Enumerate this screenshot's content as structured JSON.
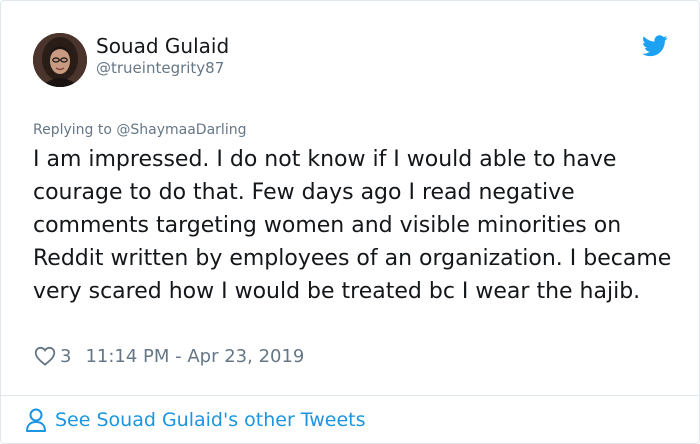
{
  "author": {
    "display_name": "Souad Gulaid",
    "handle": "@trueintegrity87"
  },
  "reply": {
    "prefix": "Replying to ",
    "mention": "@ShaymaaDarling"
  },
  "tweet": {
    "text": "I am impressed. I do not know if I would able to have courage to do that. Few days ago I read negative comments targeting women and visible minorities on Reddit written by employees of an organization. I became very scared how I would be treated bc I wear the hajib.",
    "like_count": "3",
    "timestamp": "11:14 PM - Apr 23, 2019"
  },
  "footer": {
    "link_text": "See Souad Gulaid's other Tweets"
  },
  "icons": {
    "brand": "twitter-bird-icon",
    "like": "heart-icon",
    "profile": "person-icon"
  },
  "colors": {
    "brand_blue": "#1da1f2",
    "link_blue": "#1b95e0",
    "secondary_text": "#657786",
    "primary_text": "#14171a",
    "border": "#e1e8ed"
  }
}
